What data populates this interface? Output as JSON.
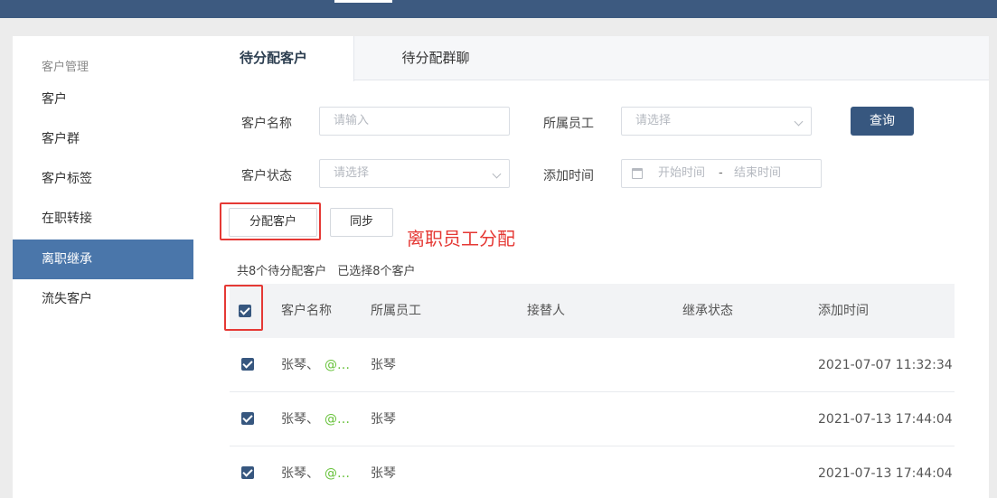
{
  "sidebar": {
    "group": "客户管理",
    "items": [
      {
        "label": "客户"
      },
      {
        "label": "客户群"
      },
      {
        "label": "客户标签"
      },
      {
        "label": "在职转接"
      },
      {
        "label": "离职继承"
      },
      {
        "label": "流失客户"
      }
    ]
  },
  "tabs": [
    {
      "label": "待分配客户"
    },
    {
      "label": "待分配群聊"
    }
  ],
  "filters": {
    "customer_name_label": "客户名称",
    "customer_name_placeholder": "请输入",
    "employee_label": "所属员工",
    "employee_placeholder": "请选择",
    "status_label": "客户状态",
    "status_placeholder": "请选择",
    "time_label": "添加时间",
    "start_placeholder": "开始时间",
    "range_sep": "-",
    "end_placeholder": "结束时间",
    "query_button": "查询"
  },
  "actions": {
    "assign_button": "分配客户",
    "sync_button": "同步",
    "annotation": "离职员工分配"
  },
  "summary": {
    "total": "共8个待分配客户",
    "selected": "已选择8个客户"
  },
  "table": {
    "headers": [
      "客户名称",
      "所属员工",
      "接替人",
      "继承状态",
      "添加时间"
    ],
    "rows": [
      {
        "name": "张琴、",
        "at": "@…",
        "employee": "张琴",
        "successor": "",
        "status": "",
        "time": "2021-07-07 11:32:34"
      },
      {
        "name": "张琴、",
        "at": "@…",
        "employee": "张琴",
        "successor": "",
        "status": "",
        "time": "2021-07-13 17:44:04"
      },
      {
        "name": "张琴、",
        "at": "@…",
        "employee": "张琴",
        "successor": "",
        "status": "",
        "time": "2021-07-13 17:44:04"
      }
    ]
  },
  "colors": {
    "topbar": "#3d5a80",
    "active_sidebar": "#4a76aa",
    "primary_button": "#37577f",
    "annotation_red": "#e53935",
    "wechat_green": "#67c23a"
  }
}
